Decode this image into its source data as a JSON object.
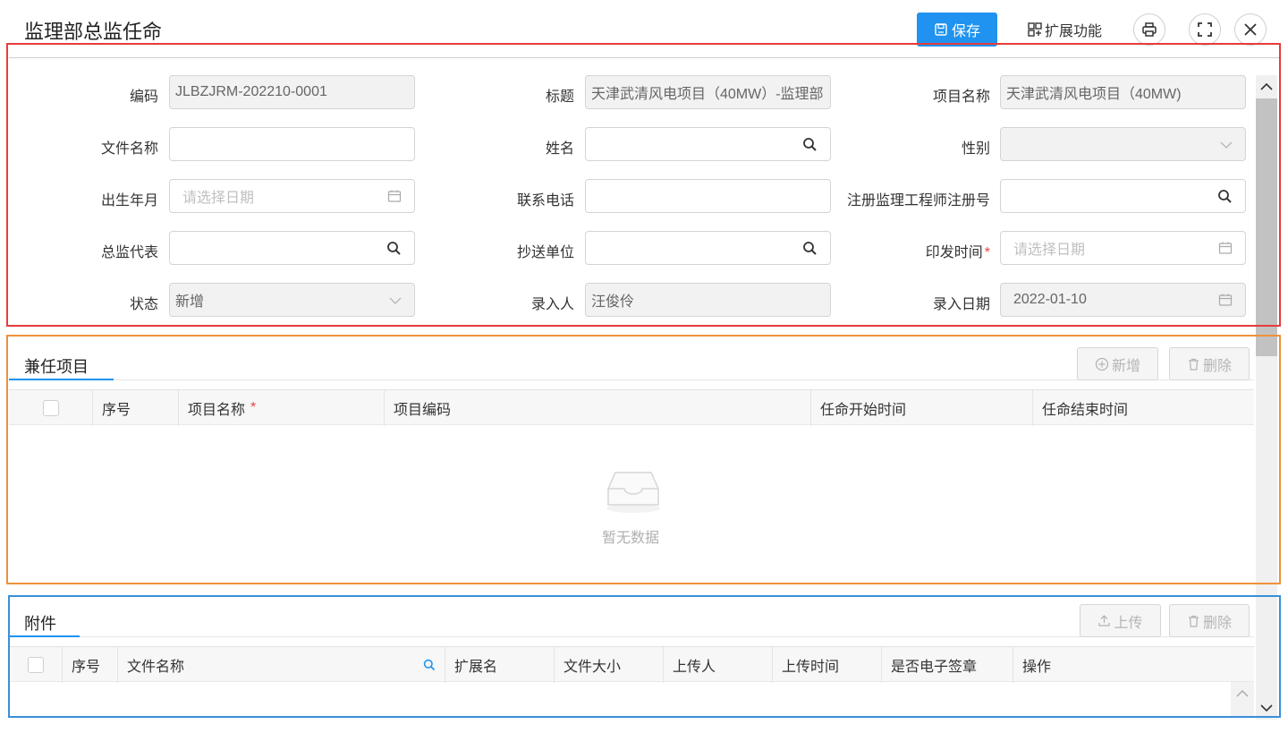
{
  "header": {
    "title": "监理部总监任命",
    "save_label": "保存",
    "ext_label": "扩展功能"
  },
  "form": {
    "code_label": "编码",
    "code_value": "JLBZJRM-202210-0001",
    "title_label": "标题",
    "title_value": "天津武清风电项目（40MW）-监理部",
    "project_label": "项目名称",
    "project_value": "天津武清风电项目（40MW)",
    "filename_label": "文件名称",
    "filename_value": "",
    "name_label": "姓名",
    "name_value": "",
    "gender_label": "性别",
    "gender_value": "",
    "birth_label": "出生年月",
    "birth_placeholder": "请选择日期",
    "phone_label": "联系电话",
    "phone_value": "",
    "regno_label": "注册监理工程师注册号",
    "regno_value": "",
    "chief_label": "总监代表",
    "chief_value": "",
    "cc_label": "抄送单位",
    "cc_value": "",
    "issue_label": "印发时间",
    "issue_placeholder": "请选择日期",
    "status_label": "状态",
    "status_value": "新增",
    "entry_person_label": "录入人",
    "entry_person_value": "汪俊伶",
    "entry_date_label": "录入日期",
    "entry_date_value": "2022-01-10",
    "required_mark": "*"
  },
  "concurrent": {
    "title": "兼任项目",
    "add_label": "新增",
    "delete_label": "删除",
    "columns": [
      "序号",
      "项目名称",
      "项目编码",
      "任命开始时间",
      "任命结束时间"
    ],
    "empty_text": "暂无数据"
  },
  "attachments": {
    "title": "附件",
    "upload_label": "上传",
    "delete_label": "删除",
    "columns": [
      "序号",
      "文件名称",
      "扩展名",
      "文件大小",
      "上传人",
      "上传时间",
      "是否电子签章",
      "操作"
    ]
  },
  "colors": {
    "primary": "#1f93ef",
    "annot_red": "#e83b3b",
    "annot_orange": "#f0913a",
    "annot_blue": "#3a8fd8"
  }
}
